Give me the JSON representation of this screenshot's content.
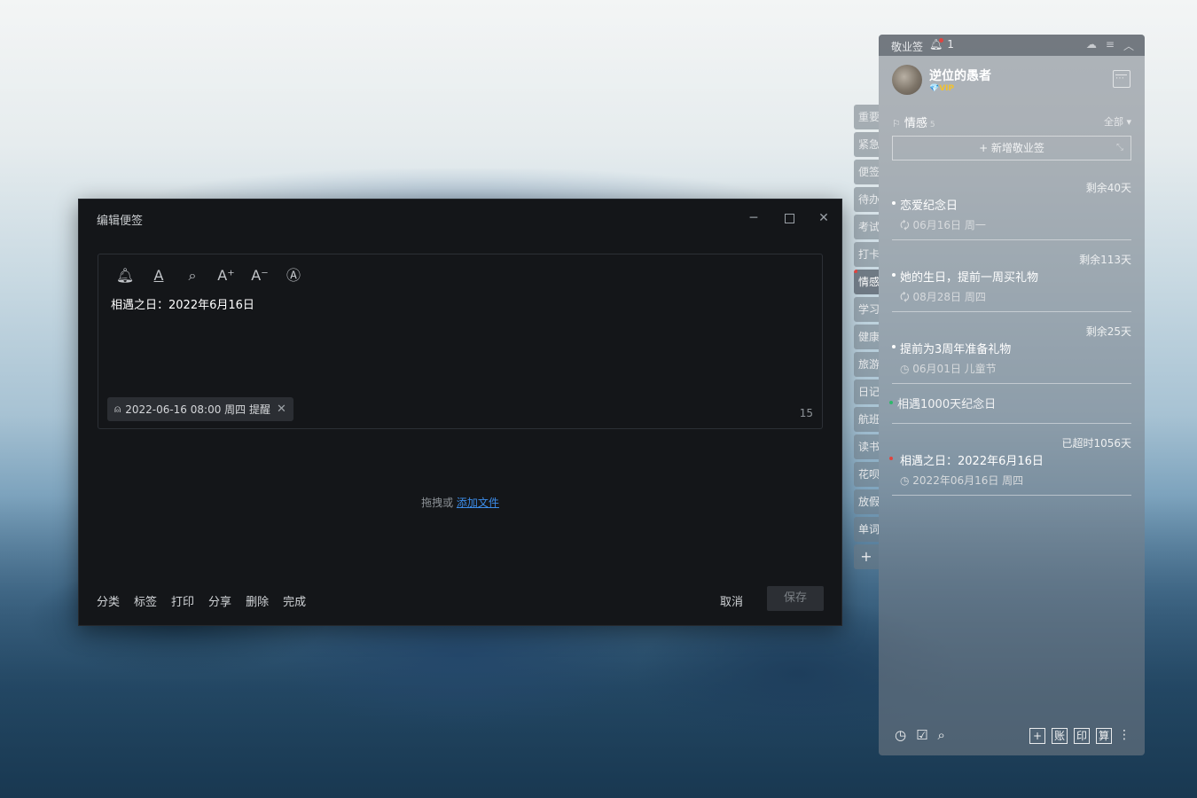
{
  "editor": {
    "title": "编辑便签",
    "window_controls": {
      "minimize": "─",
      "close": "✕"
    },
    "toolbar": [
      {
        "name": "bell-icon",
        "glyph": "🔔︎"
      },
      {
        "name": "font-color-icon",
        "glyph": "A"
      },
      {
        "name": "search-icon",
        "glyph": "⌕"
      },
      {
        "name": "font-increase-icon",
        "glyph": "A⁺"
      },
      {
        "name": "font-decrease-icon",
        "glyph": "A⁻"
      },
      {
        "name": "text-recognize-icon",
        "glyph": "Ⓐ"
      }
    ],
    "content": "相遇之日：2022年6月16日",
    "reminder": {
      "icon": "⍝",
      "text": "2022-06-16 08:00 周四 提醒",
      "close": "✕"
    },
    "char_count": "15",
    "dropzone": {
      "prefix": "拖拽或 ",
      "link": "添加文件"
    },
    "actions": [
      "分类",
      "标签",
      "打印",
      "分享",
      "删除",
      "完成"
    ],
    "cancel": "取消",
    "save": "保存"
  },
  "sidetabs": [
    "重要",
    "紧急",
    "便签",
    "待办",
    "考试",
    "打卡",
    "情感",
    "学习",
    "健康",
    "旅游",
    "日记",
    "航班",
    "读书",
    "花呗",
    "放假",
    "单词"
  ],
  "sidetab_add": "+",
  "panel": {
    "app_name": "敬业签",
    "bell_glyph": "🔔︎",
    "notification_count": "1",
    "top_icons": [
      "☁",
      "≡",
      "︿"
    ],
    "user": {
      "name": "逆位的愚者",
      "badge": "💎VIP"
    },
    "category": {
      "name": "情感",
      "count": "5",
      "filter": "全部 ▾",
      "flag": "⚐"
    },
    "new_note": "+ 新增敬业签",
    "new_note_resize": "⤡",
    "notes": [
      {
        "remain": "剩余40天",
        "title": "恋爱纪念日",
        "meta": "🗘 06月16日 周一"
      },
      {
        "remain": "剩余113天",
        "title": "她的生日，提前一周买礼物",
        "meta": "🗘 08月28日 周四"
      },
      {
        "remain": "剩余25天",
        "title": "提前为3周年准备礼物",
        "meta": "◷ 06月01日 儿童节"
      },
      {
        "remain": "",
        "title": "相遇1000天纪念日",
        "meta": ""
      },
      {
        "remain": "已超时1056天",
        "title": "相遇之日：2022年6月16日",
        "meta": "◷ 2022年06月16日 周四"
      }
    ],
    "note_bullet_colors": [
      "#ffffff",
      "#ffffff",
      "#ffffff",
      "#2fb86b",
      "#e0443f"
    ],
    "bottom_left": [
      "◷",
      "☑",
      "⌕"
    ],
    "bottom_right": [
      "+",
      "账",
      "印",
      "算"
    ],
    "more": "⋮"
  }
}
